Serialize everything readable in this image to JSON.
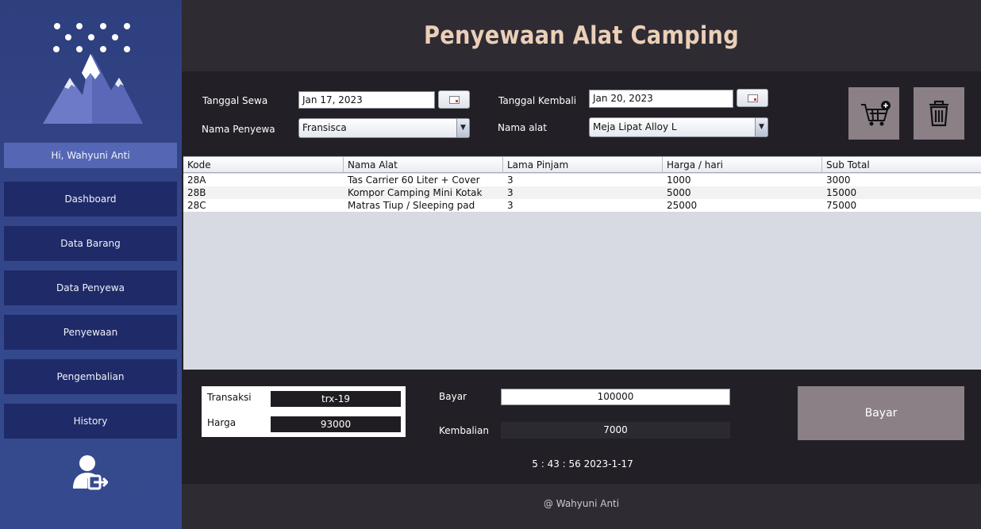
{
  "app": {
    "title": "Penyewaan Alat Camping",
    "footer": "@ Wahyuni Anti",
    "accent": "#ebcfb7"
  },
  "sidebar": {
    "greeting": "Hi, Wahyuni Anti",
    "items": [
      {
        "label": "Dashboard"
      },
      {
        "label": "Data Barang"
      },
      {
        "label": "Data Penyewa"
      },
      {
        "label": "Penyewaan"
      },
      {
        "label": "Pengembalian"
      },
      {
        "label": "History"
      }
    ],
    "logo_icon": "mountain-snow-icon",
    "logout_icon": "user-logout-icon"
  },
  "form": {
    "tanggal_sewa_label": "Tanggal Sewa",
    "tanggal_sewa_value": "Jan 17, 2023",
    "tanggal_kembali_label": "Tanggal Kembali",
    "tanggal_kembali_value": "Jan 20, 2023",
    "nama_penyewa_label": "Nama Penyewa",
    "nama_penyewa_value": "Fransisca",
    "nama_alat_label": "Nama alat",
    "nama_alat_value": "Meja Lipat Alloy L",
    "add_cart_icon": "cart-add-icon",
    "delete_icon": "trash-icon"
  },
  "table": {
    "columns": [
      "Kode",
      "Nama Alat",
      "Lama Pinjam",
      "Harga / hari",
      "Sub Total"
    ],
    "rows": [
      [
        "28A",
        "Tas Carrier 60 Liter + Cover",
        "3",
        "1000",
        "3000"
      ],
      [
        "28B",
        "Kompor Camping Mini Kotak",
        "3",
        "5000",
        "15000"
      ],
      [
        "28C",
        "Matras Tiup / Sleeping pad",
        "3",
        "25000",
        "75000"
      ]
    ]
  },
  "summary": {
    "transaksi_label": "Transaksi",
    "transaksi_value": "trx-19",
    "harga_label": "Harga",
    "harga_value": "93000",
    "bayar_label": "Bayar",
    "bayar_value": "100000",
    "kembalian_label": "Kembalian",
    "kembalian_value": "7000",
    "bayar_button": "Bayar",
    "clock": "5 : 43 : 56 2023-1-17"
  }
}
